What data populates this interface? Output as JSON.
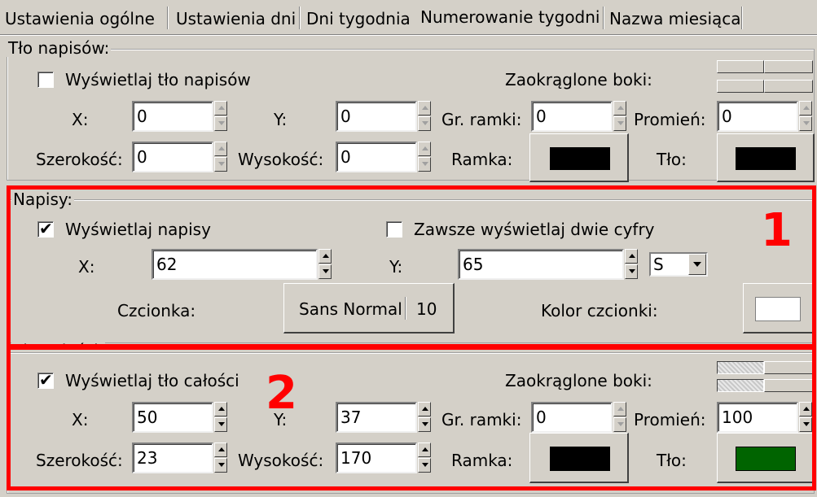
{
  "tabs": [
    {
      "label": "Ustawienia ogólne"
    },
    {
      "label": "Ustawienia dni"
    },
    {
      "label": "Dni tygodnia"
    },
    {
      "label": "Numerowanie tygodni",
      "active": true
    },
    {
      "label": "Nazwa miesiąca"
    }
  ],
  "group_text_bg": {
    "title": "Tło napisów:",
    "show_checkbox": {
      "label": "Wyświetlaj tło napisów",
      "checked": false
    },
    "rounded_label": "Zaokrąglone boki:",
    "x": {
      "label": "X:",
      "value": "0"
    },
    "y": {
      "label": "Y:",
      "value": "0"
    },
    "border_width": {
      "label": "Gr. ramki:",
      "value": "0"
    },
    "radius": {
      "label": "Promień:",
      "value": "0"
    },
    "width": {
      "label": "Szerokość:",
      "value": "0"
    },
    "height": {
      "label": "Wysokość:",
      "value": "0"
    },
    "frame": {
      "label": "Ramka:",
      "color": "#000000"
    },
    "background": {
      "label": "Tło:",
      "color": "#000000"
    }
  },
  "group_labels": {
    "title": "Napisy:",
    "show_checkbox": {
      "label": "Wyświetlaj napisy",
      "checked": true
    },
    "two_digits_checkbox": {
      "label": "Zawsze wyświetlaj dwie cyfry",
      "checked": false
    },
    "x": {
      "label": "X:",
      "value": "62"
    },
    "y": {
      "label": "Y:",
      "value": "65"
    },
    "align_select": {
      "value": "S"
    },
    "font": {
      "label": "Czcionka:",
      "name": "Sans Normal",
      "size": "10"
    },
    "font_color": {
      "label": "Kolor czcionki:",
      "color": "#ffffff"
    }
  },
  "group_whole_bg": {
    "title": "Tło całości:",
    "show_checkbox": {
      "label": "Wyświetlaj tło całości",
      "checked": true
    },
    "rounded_label": "Zaokrąglone boki:",
    "x": {
      "label": "X:",
      "value": "50"
    },
    "y": {
      "label": "Y:",
      "value": "37"
    },
    "border_width": {
      "label": "Gr. ramki:",
      "value": "0"
    },
    "radius": {
      "label": "Promień:",
      "value": "100"
    },
    "width": {
      "label": "Szerokość:",
      "value": "23"
    },
    "height": {
      "label": "Wysokość:",
      "value": "170"
    },
    "frame": {
      "label": "Ramka:",
      "color": "#000000"
    },
    "background": {
      "label": "Tło:",
      "color": "#006400"
    }
  },
  "annotations": [
    {
      "label": "1",
      "color": "#ff0000"
    },
    {
      "label": "2",
      "color": "#ff0000"
    }
  ],
  "checkmark": "✔"
}
